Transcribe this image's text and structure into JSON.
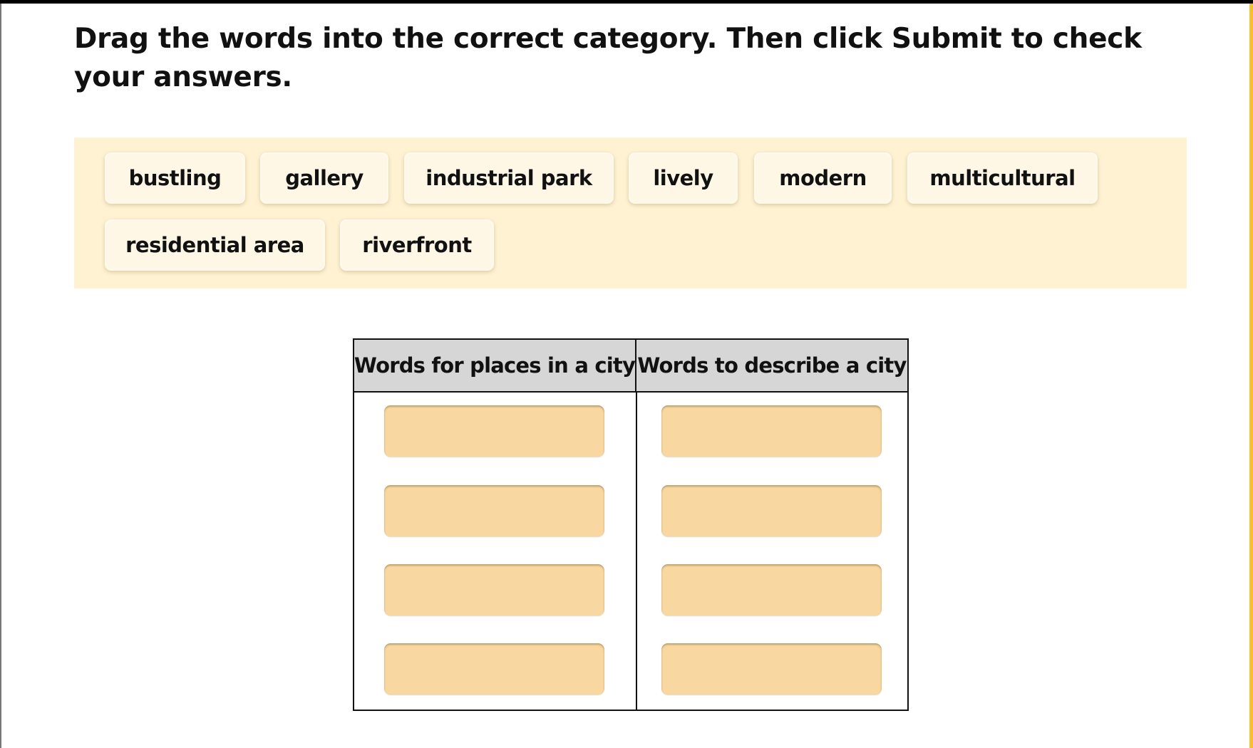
{
  "instructions": "Drag the words into the correct category. Then click Submit to check your answers.",
  "word_bank": {
    "words": [
      "bustling",
      "gallery",
      "industrial park",
      "lively",
      "modern",
      "multicultural",
      "residential area",
      "riverfront"
    ]
  },
  "categories": [
    {
      "header": "Words for places in a city",
      "slots": 4,
      "filled": []
    },
    {
      "header": "Words to describe a city",
      "slots": 4,
      "filled": []
    }
  ],
  "colors": {
    "word_bank_bg": "#fef2d3",
    "chip_bg": "#fef7e6",
    "dropzone_bg": "#f8d8a0",
    "header_bg": "#d6d6d6",
    "accent_bar": "#f7c12b"
  }
}
